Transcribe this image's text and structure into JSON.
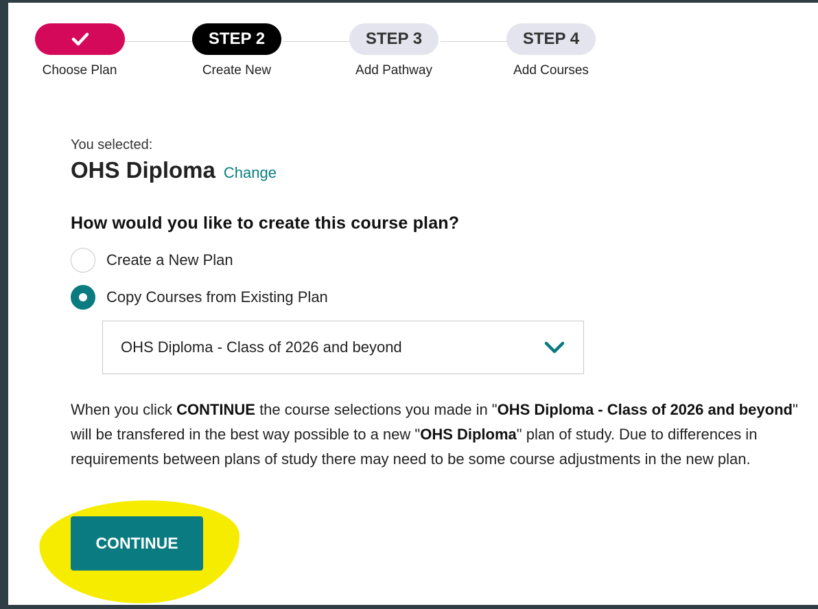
{
  "stepper": {
    "steps": [
      {
        "pill": "",
        "label": "Choose Plan",
        "state": "done"
      },
      {
        "pill": "STEP 2",
        "label": "Create New",
        "state": "current"
      },
      {
        "pill": "STEP 3",
        "label": "Add Pathway",
        "state": "future"
      },
      {
        "pill": "STEP 4",
        "label": "Add Courses",
        "state": "future"
      }
    ]
  },
  "selection": {
    "label": "You selected:",
    "plan_name": "OHS Diploma",
    "change_link": "Change"
  },
  "question": "How would you like to create this course plan?",
  "options": [
    {
      "label": "Create a New Plan",
      "checked": false
    },
    {
      "label": "Copy Courses from Existing Plan",
      "checked": true
    }
  ],
  "existing_plan_select": {
    "value": "OHS Diploma - Class of 2026 and beyond",
    "icon": "chevron-down-icon"
  },
  "info": {
    "t1": "When you click ",
    "b1": "CONTINUE",
    "t2": " the course selections you made in \"",
    "b2": "OHS Diploma - Class of 2026 and beyond",
    "t3": "\" will be transfered in the best way possible to a new \"",
    "b3": "OHS Diploma",
    "t4": "\" plan of study. Due to differences in requirements between plans of study there may need to be some course adjustments in the new plan."
  },
  "continue_button": "CONTINUE",
  "colors": {
    "accent_teal": "#0a7b80",
    "done_pink": "#d4095a",
    "highlight_yellow": "#f6ec00"
  }
}
